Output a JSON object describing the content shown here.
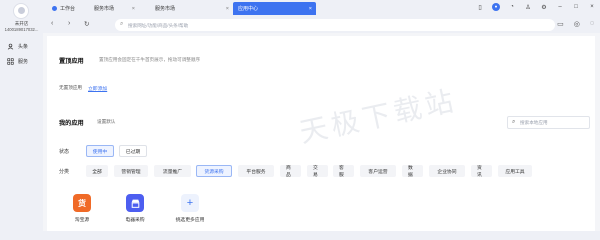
{
  "profile": {
    "name": "未开店",
    "id": "1400189017032..."
  },
  "nav": [
    {
      "label": "头条",
      "icon": "user-icon"
    },
    {
      "label": "服务",
      "icon": "grid-icon"
    }
  ],
  "tabs": [
    {
      "label": "工作台",
      "icon": "workbench-icon",
      "active": false
    },
    {
      "label": "服务市场",
      "active": false
    },
    {
      "label": "服务市场",
      "active": false
    },
    {
      "label": "应用中心",
      "active": true
    }
  ],
  "window_controls": [
    "phone-icon",
    "avatar-icon",
    "bell-icon",
    "shirt-icon",
    "settings-icon",
    "minimize-icon",
    "maximize-icon",
    "close-icon"
  ],
  "addressbar": {
    "placeholder": "搜索网址/功能/商品/头条/帮助",
    "right_icons": [
      "folder-icon",
      "refresh-circle-icon",
      "chat-icon"
    ]
  },
  "pinned": {
    "title": "置顶应用",
    "desc": "置顶应用会固定在千牛首页展示，拖动可调整顺序",
    "empty_text": "无置顶应用",
    "add_link": "立即添加"
  },
  "mine": {
    "title": "我的应用",
    "settings_link": "设置默认",
    "search_placeholder": "搜索本地应用"
  },
  "filters": {
    "status_label": "状态",
    "status": [
      {
        "label": "使用中",
        "selected": true
      },
      {
        "label": "已过期",
        "selected": false
      }
    ],
    "category_label": "分类",
    "categories": [
      {
        "label": "全部",
        "selected": false
      },
      {
        "label": "营销管理",
        "selected": false
      },
      {
        "label": "流量推广",
        "selected": false
      },
      {
        "label": "货源采购",
        "selected": true
      },
      {
        "label": "平台服务",
        "selected": false
      },
      {
        "label": "商品",
        "selected": false
      },
      {
        "label": "交易",
        "selected": false
      },
      {
        "label": "客服",
        "selected": false
      },
      {
        "label": "客户运营",
        "selected": false
      },
      {
        "label": "数据",
        "selected": false
      },
      {
        "label": "企业协同",
        "selected": false
      },
      {
        "label": "资讯",
        "selected": false
      },
      {
        "label": "应用工具",
        "selected": false
      }
    ]
  },
  "apps": [
    {
      "name": "淘宝源",
      "icon": "taoyuan-icon",
      "color": "#f06a27"
    },
    {
      "name": "电器采购",
      "icon": "shop-icon",
      "color": "#4d5ef0"
    },
    {
      "name": "挑选更多应用",
      "icon": "plus-icon",
      "color": "#edf2fd"
    }
  ],
  "watermark": "天极下载站",
  "colors": {
    "accent": "#3d73f0"
  }
}
